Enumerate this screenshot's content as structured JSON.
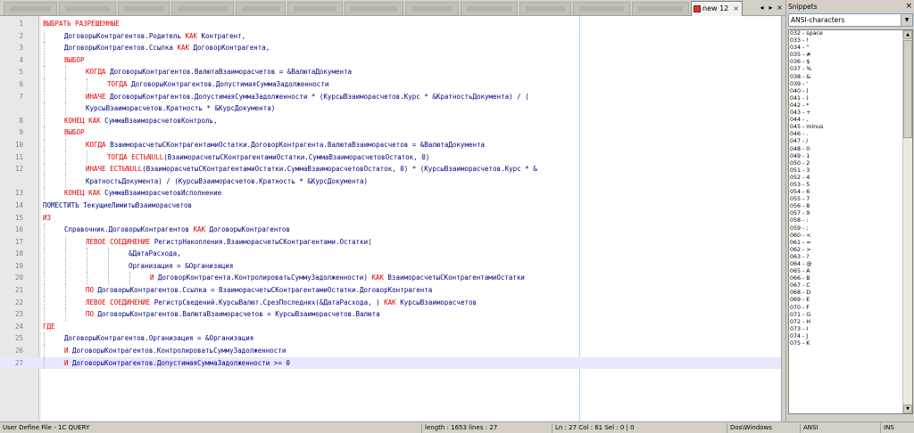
{
  "tabs": {
    "active": {
      "label": "new  12",
      "close": "×"
    },
    "scroll_left": "◂",
    "scroll_right": "▸",
    "close_all": "×"
  },
  "editor": {
    "current_line": 27,
    "lines": [
      {
        "n": "1",
        "indent": 0,
        "tokens": [
          [
            "kw",
            "ВЫБРАТЬ РАЗРЕШЕННЫЕ"
          ]
        ]
      },
      {
        "n": "2",
        "indent": 1,
        "tokens": [
          [
            "id",
            "ДоговорыКонтрагентов.Родитель "
          ],
          [
            "kw",
            "КАК"
          ],
          [
            "id",
            " Контрагент,"
          ]
        ]
      },
      {
        "n": "3",
        "indent": 1,
        "tokens": [
          [
            "id",
            "ДоговорыКонтрагентов.Ссылка "
          ],
          [
            "kw",
            "КАК"
          ],
          [
            "id",
            " ДоговорКонтрагента,"
          ]
        ]
      },
      {
        "n": "4",
        "indent": 1,
        "tokens": [
          [
            "kw",
            "ВЫБОР"
          ]
        ]
      },
      {
        "n": "5",
        "indent": 2,
        "tokens": [
          [
            "kw",
            "КОГДА"
          ],
          [
            "id",
            " ДоговорыКонтрагентов.ВалютаВзаиморасчетов = &ВалютаДокумента"
          ]
        ]
      },
      {
        "n": "6",
        "indent": 3,
        "tokens": [
          [
            "kw",
            "ТОГДА"
          ],
          [
            "id",
            " ДоговорыКонтрагентов.ДопустимаяСуммаЗадолженности"
          ]
        ]
      },
      {
        "n": "7",
        "indent": 2,
        "tokens": [
          [
            "kw",
            "ИНАЧЕ"
          ],
          [
            "id",
            " ДоговорыКонтрагентов.ДопустимаяСуммаЗадолженности * (КурсыВзаиморасчетов.Курс * &КратностьДокумента) / ("
          ]
        ]
      },
      {
        "n": "",
        "indent": 2,
        "tokens": [
          [
            "id",
            "КурсыВзаиморасчетов.Кратность * &КурсДокумента)"
          ]
        ]
      },
      {
        "n": "8",
        "indent": 1,
        "tokens": [
          [
            "kw",
            "КОНЕЦ"
          ],
          [
            "id",
            " "
          ],
          [
            "kw",
            "КАК"
          ],
          [
            "id",
            " СуммаВзаиморасчетовКонтроль,"
          ]
        ]
      },
      {
        "n": "9",
        "indent": 1,
        "tokens": [
          [
            "kw",
            "ВЫБОР"
          ]
        ]
      },
      {
        "n": "10",
        "indent": 2,
        "tokens": [
          [
            "kw",
            "КОГДА"
          ],
          [
            "id",
            " ВзаиморасчетыСКонтрагентамиОстатки.ДоговорКонтрагента.ВалютаВзаиморасчетов = &ВалютаДокумента"
          ]
        ]
      },
      {
        "n": "11",
        "indent": 3,
        "tokens": [
          [
            "kw",
            "ТОГДА"
          ],
          [
            "id",
            " "
          ],
          [
            "kw",
            "ЕСТЬNULL"
          ],
          [
            "id",
            "(ВзаиморасчетыСКонтрагентамиОстатки.СуммаВзаиморасчетовОстаток, 0)"
          ]
        ]
      },
      {
        "n": "12",
        "indent": 2,
        "tokens": [
          [
            "kw",
            "ИНАЧЕ"
          ],
          [
            "id",
            " "
          ],
          [
            "kw",
            "ЕСТЬNULL"
          ],
          [
            "id",
            "(ВзаиморасчетыСКонтрагентамиОстатки.СуммаВзаиморасчетовОстаток, 0) * (КурсыВзаиморасчетов.Курс * &"
          ]
        ]
      },
      {
        "n": "",
        "indent": 2,
        "tokens": [
          [
            "id",
            "КратностьДокумента) / (КурсыВзаиморасчетов.Кратность * &КурсДокумента)"
          ]
        ]
      },
      {
        "n": "13",
        "indent": 1,
        "tokens": [
          [
            "kw",
            "КОНЕЦ"
          ],
          [
            "id",
            " "
          ],
          [
            "kw",
            "КАК"
          ],
          [
            "id",
            " СуммаВзаиморасчетовИсполнение"
          ]
        ]
      },
      {
        "n": "14",
        "indent": 0,
        "tokens": [
          [
            "id",
            "ПОМЕСТИТЬ ТекущиеЛимитыВзаиморасчетов"
          ]
        ]
      },
      {
        "n": "15",
        "indent": 0,
        "tokens": [
          [
            "kw",
            "ИЗ"
          ]
        ]
      },
      {
        "n": "16",
        "indent": 1,
        "tokens": [
          [
            "id",
            "Справочник.ДоговорыКонтрагентов "
          ],
          [
            "kw",
            "КАК"
          ],
          [
            "id",
            " ДоговорыКонтрагентов"
          ]
        ]
      },
      {
        "n": "17",
        "indent": 2,
        "tokens": [
          [
            "kw",
            "ЛЕВОЕ СОЕДИНЕНИЕ"
          ],
          [
            "id",
            " РегистрНакопления.ВзаиморасчетыСКонтрагентами.Остатки("
          ]
        ]
      },
      {
        "n": "18",
        "indent": 4,
        "tokens": [
          [
            "id",
            "&ДатаРасхода,"
          ]
        ]
      },
      {
        "n": "19",
        "indent": 4,
        "tokens": [
          [
            "id",
            "Организация = &Организация"
          ]
        ]
      },
      {
        "n": "20",
        "indent": 5,
        "tokens": [
          [
            "kw",
            "И"
          ],
          [
            "id",
            " ДоговорКонтрагента.КонтролироватьСуммуЗадолженности) "
          ],
          [
            "kw",
            "КАК"
          ],
          [
            "id",
            " ВзаиморасчетыСКонтрагентамиОстатки"
          ]
        ]
      },
      {
        "n": "21",
        "indent": 2,
        "tokens": [
          [
            "kw",
            "ПО"
          ],
          [
            "id",
            " ДоговорыКонтрагентов.Ссылка = ВзаиморасчетыСКонтрагентамиОстатки.ДоговорКонтрагента"
          ]
        ]
      },
      {
        "n": "22",
        "indent": 2,
        "tokens": [
          [
            "kw",
            "ЛЕВОЕ СОЕДИНЕНИЕ"
          ],
          [
            "id",
            " РегистрСведений.КурсыВалют.СрезПоследних(&ДатаРасхода, ) "
          ],
          [
            "kw",
            "КАК"
          ],
          [
            "id",
            " КурсыВзаиморасчетов"
          ]
        ]
      },
      {
        "n": "23",
        "indent": 2,
        "tokens": [
          [
            "kw",
            "ПО"
          ],
          [
            "id",
            " ДоговорыКонтрагентов.ВалютаВзаиморасчетов = КурсыВзаиморасчетов.Валюта"
          ]
        ]
      },
      {
        "n": "24",
        "indent": 0,
        "tokens": [
          [
            "kw",
            "ГДЕ"
          ]
        ]
      },
      {
        "n": "25",
        "indent": 1,
        "tokens": [
          [
            "id",
            "ДоговорыКонтрагентов.Организация = &Организация"
          ]
        ]
      },
      {
        "n": "26",
        "indent": 1,
        "tokens": [
          [
            "kw",
            "И"
          ],
          [
            "id",
            " ДоговорыКонтрагентов.КонтролироватьСуммуЗадолженности"
          ]
        ]
      },
      {
        "n": "27",
        "indent": 1,
        "tokens": [
          [
            "kw",
            "И"
          ],
          [
            "id",
            " ДоговорыКонтрагентов.ДопустимаяСуммаЗадолженности >= 0"
          ]
        ]
      }
    ]
  },
  "snippets": {
    "title": "Snippets",
    "close": "×",
    "category": "ANSI-characters",
    "items": [
      "032 - space",
      "033 - !",
      "034 - \"",
      "035 - #",
      "036 - $",
      "037 - %",
      "038 - &",
      "039 - '",
      "040 - (",
      "041 - )",
      "042 - *",
      "043 - +",
      "044 - ,",
      "045 - minus",
      "046 - .",
      "047 - /",
      "048 - 0",
      "049 - 1",
      "050 - 2",
      "051 - 3",
      "052 - 4",
      "053 - 5",
      "054 - 6",
      "055 - 7",
      "056 - 8",
      "057 - 9",
      "058 - :",
      "059 - ;",
      "060 - <",
      "061 - =",
      "062 - >",
      "063 - ?",
      "064 - @",
      "065 - A",
      "066 - B",
      "067 - C",
      "068 - D",
      "069 - E",
      "070 - F",
      "071 - G",
      "072 - H",
      "073 - I",
      "074 - J",
      "075 - K"
    ]
  },
  "status": {
    "language": "User Define File - 1C QUERY",
    "length": "length : 1653    lines : 27",
    "position": "Ln : 27    Col : 61    Sel : 0 | 0",
    "eol": "Dos\\Windows",
    "encoding": "ANSI",
    "mode": "INS"
  }
}
